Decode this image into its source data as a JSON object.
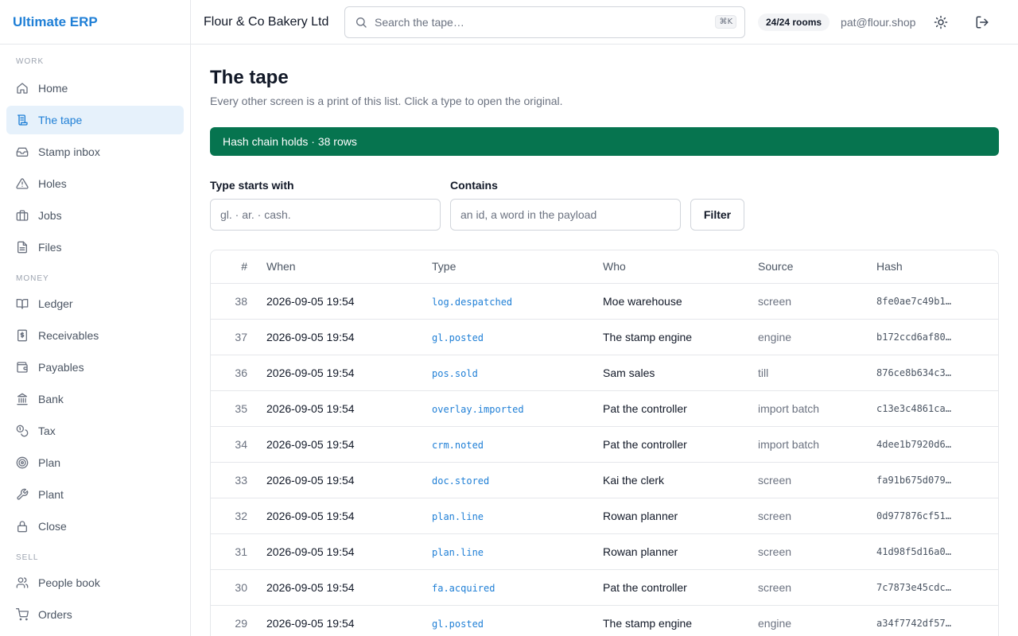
{
  "app": {
    "name": "Ultimate ERP"
  },
  "sidebar": {
    "sections": [
      {
        "label": "WORK",
        "items": [
          {
            "label": "Home",
            "icon": "home-icon",
            "active": false
          },
          {
            "label": "The tape",
            "icon": "scroll-icon",
            "active": true
          },
          {
            "label": "Stamp inbox",
            "icon": "inbox-icon",
            "active": false
          },
          {
            "label": "Holes",
            "icon": "warning-icon",
            "active": false
          },
          {
            "label": "Jobs",
            "icon": "briefcase-icon",
            "active": false
          },
          {
            "label": "Files",
            "icon": "file-icon",
            "active": false
          }
        ]
      },
      {
        "label": "MONEY",
        "items": [
          {
            "label": "Ledger",
            "icon": "book-icon",
            "active": false
          },
          {
            "label": "Receivables",
            "icon": "receipt-icon",
            "active": false
          },
          {
            "label": "Payables",
            "icon": "wallet-icon",
            "active": false
          },
          {
            "label": "Bank",
            "icon": "bank-icon",
            "active": false
          },
          {
            "label": "Tax",
            "icon": "coins-icon",
            "active": false
          },
          {
            "label": "Plan",
            "icon": "target-icon",
            "active": false
          },
          {
            "label": "Plant",
            "icon": "wrench-icon",
            "active": false
          },
          {
            "label": "Close",
            "icon": "lock-icon",
            "active": false
          }
        ]
      },
      {
        "label": "SELL",
        "items": [
          {
            "label": "People book",
            "icon": "users-icon",
            "active": false
          },
          {
            "label": "Orders",
            "icon": "cart-icon",
            "active": false
          }
        ]
      }
    ]
  },
  "header": {
    "org": "Flour & Co Bakery Ltd",
    "search_placeholder": "Search the tape…",
    "shortcut": "⌘K",
    "rooms": "24/24 rooms",
    "user": "pat@flour.shop"
  },
  "page": {
    "title": "The tape",
    "subtitle": "Every other screen is a print of this list. Click a type to open the original.",
    "banner": "Hash chain holds · 38 rows",
    "colors": {
      "accent": "#1f7fd6",
      "banner": "#06744f"
    }
  },
  "filters": {
    "type_label": "Type starts with",
    "type_placeholder": "gl. · ar. · cash.",
    "contains_label": "Contains",
    "contains_placeholder": "an id, a word in the payload",
    "button": "Filter"
  },
  "table": {
    "columns": [
      "#",
      "When",
      "Type",
      "Who",
      "Source",
      "Hash"
    ],
    "rows": [
      {
        "n": "38",
        "when": "2026-09-05 19:54",
        "type": "log.despatched",
        "who": "Moe warehouse",
        "source": "screen",
        "hash": "8fe0ae7c49b1…"
      },
      {
        "n": "37",
        "when": "2026-09-05 19:54",
        "type": "gl.posted",
        "who": "The stamp engine",
        "source": "engine",
        "hash": "b172ccd6af80…"
      },
      {
        "n": "36",
        "when": "2026-09-05 19:54",
        "type": "pos.sold",
        "who": "Sam sales",
        "source": "till",
        "hash": "876ce8b634c3…"
      },
      {
        "n": "35",
        "when": "2026-09-05 19:54",
        "type": "overlay.imported",
        "who": "Pat the controller",
        "source": "import batch",
        "hash": "c13e3c4861ca…"
      },
      {
        "n": "34",
        "when": "2026-09-05 19:54",
        "type": "crm.noted",
        "who": "Pat the controller",
        "source": "import batch",
        "hash": "4dee1b7920d6…"
      },
      {
        "n": "33",
        "when": "2026-09-05 19:54",
        "type": "doc.stored",
        "who": "Kai the clerk",
        "source": "screen",
        "hash": "fa91b675d079…"
      },
      {
        "n": "32",
        "when": "2026-09-05 19:54",
        "type": "plan.line",
        "who": "Rowan planner",
        "source": "screen",
        "hash": "0d977876cf51…"
      },
      {
        "n": "31",
        "when": "2026-09-05 19:54",
        "type": "plan.line",
        "who": "Rowan planner",
        "source": "screen",
        "hash": "41d98f5d16a0…"
      },
      {
        "n": "30",
        "when": "2026-09-05 19:54",
        "type": "fa.acquired",
        "who": "Pat the controller",
        "source": "screen",
        "hash": "7c7873e45cdc…"
      },
      {
        "n": "29",
        "when": "2026-09-05 19:54",
        "type": "gl.posted",
        "who": "The stamp engine",
        "source": "engine",
        "hash": "a34f7742df57…"
      }
    ]
  }
}
